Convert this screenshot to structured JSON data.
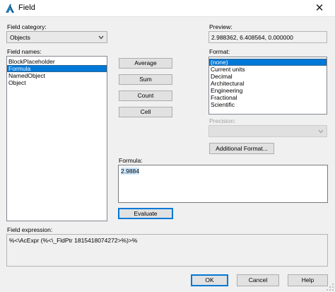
{
  "window": {
    "title": "Field",
    "close_glyph": "✕",
    "icons": {
      "app": "autocad-a-icon",
      "close": "close-icon"
    }
  },
  "field_category": {
    "label": "Field category:",
    "selected": "Objects"
  },
  "field_names": {
    "label": "Field names:",
    "items": [
      "BlockPlaceholder",
      "Formula",
      "NamedObject",
      "Object"
    ],
    "selected_index": 1
  },
  "formula_buttons": {
    "average": "Average",
    "sum": "Sum",
    "count": "Count",
    "cell": "Cell"
  },
  "preview": {
    "label": "Preview:",
    "value": "2.988362, 6.408564, 0.000000"
  },
  "format": {
    "label": "Format:",
    "items": [
      "(none)",
      "Current units",
      "Decimal",
      "Architectural",
      "Engineering",
      "Fractional",
      "Scientific"
    ],
    "selected_index": 0
  },
  "precision": {
    "label": "Precision:",
    "selected": ""
  },
  "additional_format_label": "Additional Format...",
  "formula": {
    "label": "Formula:",
    "value": "2.9884"
  },
  "evaluate_label": "Evaluate",
  "field_expression": {
    "label": "Field expression:",
    "value": "%<\\AcExpr (%<\\_FldPtr 1815418074272>%)>%"
  },
  "dialog_buttons": {
    "ok": "OK",
    "cancel": "Cancel",
    "help": "Help"
  },
  "colors": {
    "selection": "#0078d7",
    "window_bg": "#f0f0f0",
    "text_selection": "#cce8ff"
  }
}
